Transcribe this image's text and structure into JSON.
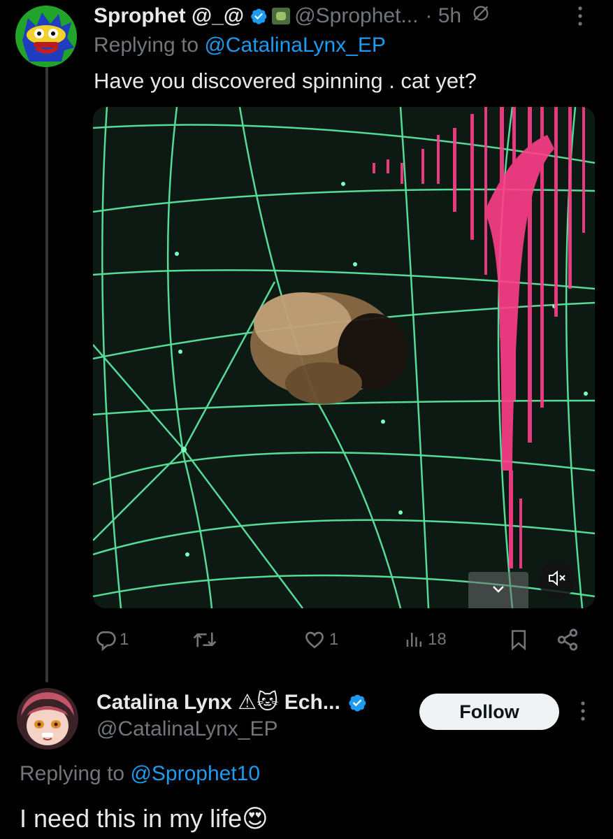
{
  "tweet1": {
    "display_name": "Sprophet @_@",
    "handle": "@Sprophet...",
    "time": "· 5h",
    "replying_prefix": "Replying to ",
    "replying_to": "@CatalinaLynx_EP",
    "text": "Have you discovered spinning . cat yet?",
    "stats": {
      "replies": "1",
      "likes": "1",
      "views": "18"
    }
  },
  "tweet2": {
    "display_name": "Catalina Lynx ⚠🐱 Ech...",
    "handle": "@CatalinaLynx_EP",
    "follow_label": "Follow",
    "replying_prefix": "Replying to ",
    "replying_to": "@Sprophet10",
    "text": "I need this in my life😍"
  },
  "icons": {
    "verified": "verified-badge-icon",
    "muted": "muted-thread-icon",
    "more": "more-options-icon",
    "reply": "reply-icon",
    "retweet": "retweet-icon",
    "like": "heart-icon",
    "views": "views-icon",
    "bookmark": "bookmark-icon",
    "share": "share-icon",
    "mute_video": "mute-video-icon",
    "expand": "chevron-down-icon"
  },
  "colors": {
    "background": "#000000",
    "link": "#1d9bf0",
    "muted_text": "#71767b",
    "primary_text": "#e7e9ea",
    "follow_bg": "#eff3f4"
  }
}
